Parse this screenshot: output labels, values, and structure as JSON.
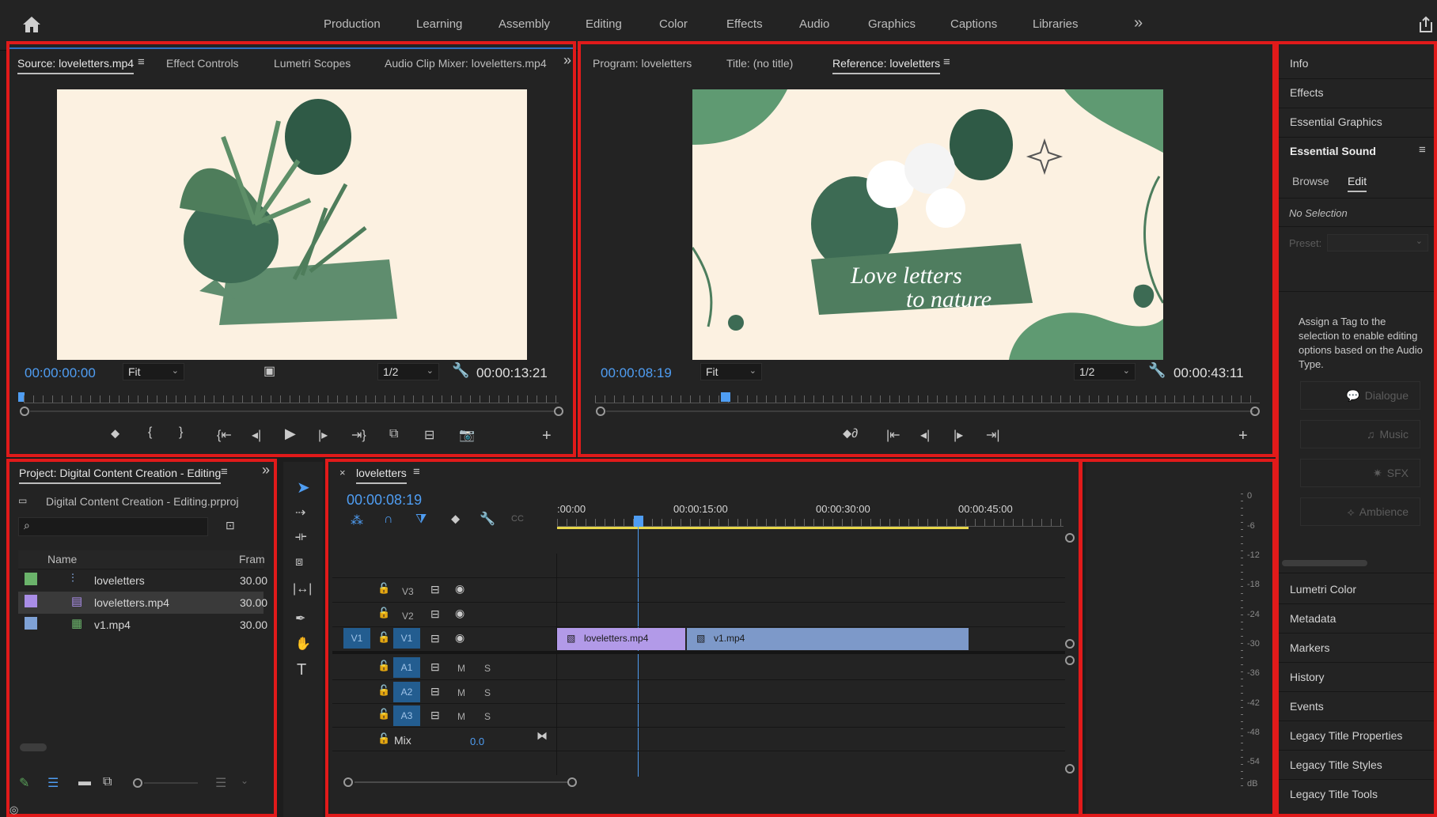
{
  "workspaces": [
    "Production",
    "Learning",
    "Assembly",
    "Editing",
    "Color",
    "Effects",
    "Audio",
    "Graphics",
    "Captions",
    "Libraries"
  ],
  "topbar": {
    "more_label": "»"
  },
  "source": {
    "tabs": [
      "Source: loveletters.mp4",
      "Effect Controls",
      "Lumetri Scopes",
      "Audio Clip Mixer: loveletters.mp4"
    ],
    "timecode_in": "00:00:00:00",
    "fit": "Fit",
    "resolution": "1/2",
    "timecode_dur": "00:00:13:21"
  },
  "program": {
    "tabs": [
      "Program: loveletters",
      "Title: (no title)",
      "Reference: loveletters"
    ],
    "timecode_in": "00:00:08:19",
    "fit": "Fit",
    "resolution": "1/2",
    "timecode_dur": "00:00:43:11",
    "title_line1": "Love letters",
    "title_line2": "to nature"
  },
  "project": {
    "tab": "Project: Digital Content Creation - Editing",
    "filename": "Digital Content Creation - Editing.prproj",
    "col_name": "Name",
    "col_frame": "Fram",
    "items": [
      {
        "name": "loveletters",
        "rate": "30.00",
        "color": "#6bb36b"
      },
      {
        "name": "loveletters.mp4",
        "rate": "30.00",
        "color": "#a98de6"
      },
      {
        "name": "v1.mp4",
        "rate": "30.00",
        "color": "#7fa2d6"
      }
    ]
  },
  "timeline": {
    "tab": "loveletters",
    "close": "×",
    "timecode": "00:00:08:19",
    "ruler_labels": [
      ":00:00",
      "00:00:15:00",
      "00:00:30:00",
      "00:00:45:00"
    ],
    "tracks_video": [
      "V3",
      "V2",
      "V1"
    ],
    "tracks_audio": [
      "A1",
      "A2",
      "A3"
    ],
    "src_patch": "V1",
    "mix_label": "Mix",
    "mix_value": "0.0",
    "m_label": "M",
    "s_label": "S",
    "clips": [
      {
        "name": "loveletters.mp4",
        "color": "#b29ae8"
      },
      {
        "name": "v1.mp4",
        "color": "#7d99c9"
      }
    ]
  },
  "meter": {
    "labels": [
      "0",
      "-6",
      "-12",
      "-18",
      "-24",
      "-30",
      "-36",
      "-42",
      "-48",
      "-54",
      "dB"
    ]
  },
  "side": {
    "top_items": [
      "Info",
      "Effects",
      "Essential Graphics",
      "Essential Sound"
    ],
    "tabs": [
      "Browse",
      "Edit"
    ],
    "no_selection": "No Selection",
    "preset": "Preset:",
    "assign_text": "Assign a Tag to the selection to enable editing options based on the Audio Type.",
    "types": [
      "Dialogue",
      "Music",
      "SFX",
      "Ambience"
    ],
    "bottom_items": [
      "Lumetri Color",
      "Metadata",
      "Markers",
      "History",
      "Events",
      "Legacy Title Properties",
      "Legacy Title Styles",
      "Legacy Title Tools"
    ]
  },
  "colors": {
    "accent": "#4f9df2",
    "annotation": "#e11a1a"
  }
}
